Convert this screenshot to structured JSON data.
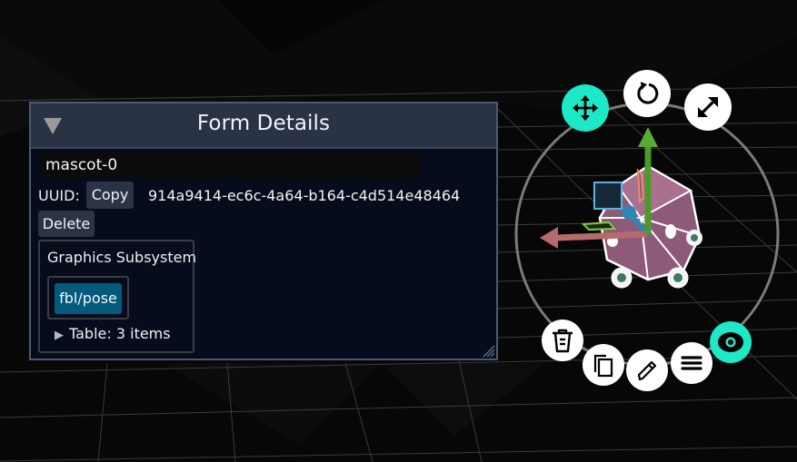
{
  "panel": {
    "title": "Form Details",
    "collapse_icon": "triangle-down-icon",
    "name_value": "mascot-0",
    "uuid_label": "UUID:",
    "copy_label": "Copy",
    "uuid_value": "914a9414-ec6c-4a64-b164-c4d514e48464",
    "delete_label": "Delete",
    "subsystem": {
      "title": "Graphics Subsystem",
      "tag_label": "fbl/pose",
      "table_label": "Table: 3 items",
      "table_toggle_icon": "triangle-right-icon"
    }
  },
  "gizmo": {
    "tools": [
      {
        "name": "translate",
        "icon": "move-arrows-icon",
        "active": true
      },
      {
        "name": "rotate",
        "icon": "rotate-icon",
        "active": false
      },
      {
        "name": "scale",
        "icon": "resize-diagonal-icon",
        "active": false
      }
    ],
    "actions": [
      {
        "name": "delete",
        "icon": "trash-icon",
        "active": false
      },
      {
        "name": "duplicate",
        "icon": "copy-icon",
        "active": false
      },
      {
        "name": "edit",
        "icon": "pencil-icon",
        "active": false
      },
      {
        "name": "menu",
        "icon": "menu-icon",
        "active": false
      },
      {
        "name": "visibility",
        "icon": "eye-icon",
        "active": true
      }
    ],
    "colors": {
      "active": "#1de9c8",
      "inactive": "#ffffff",
      "x_axis": "#b56b6b",
      "y_axis": "#4a9a2c",
      "z_axis": "#2f86b0",
      "model": "#8e5a7a"
    }
  }
}
